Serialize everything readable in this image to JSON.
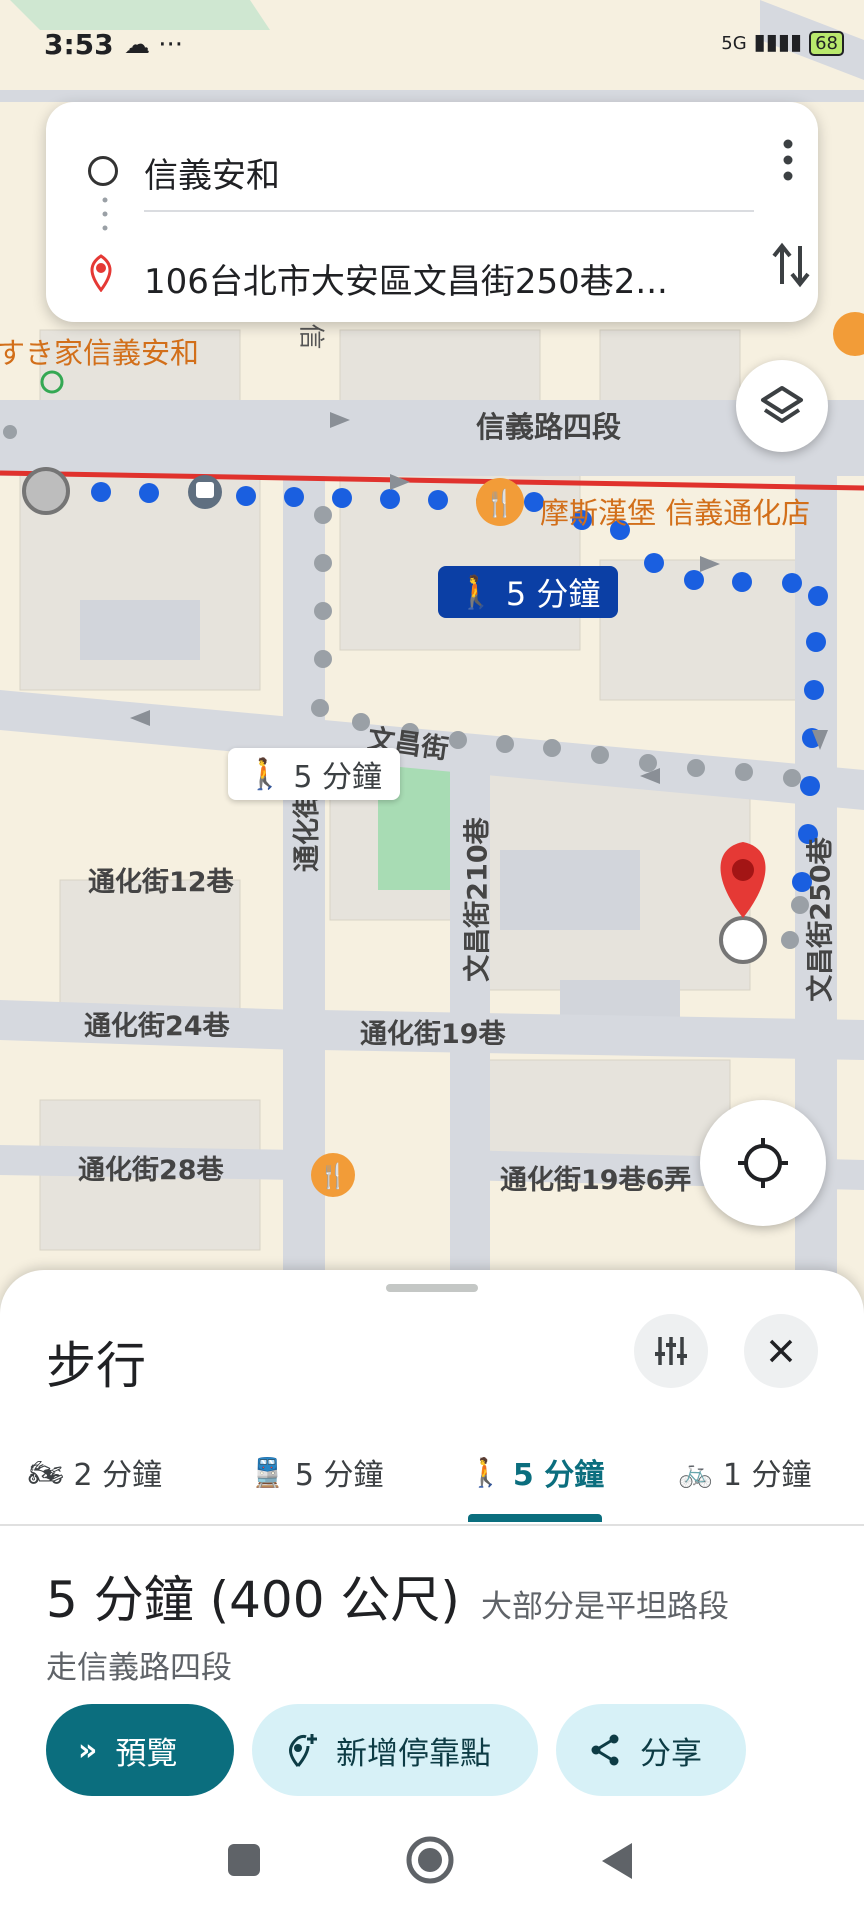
{
  "status_bar": {
    "time": "3:53",
    "extra": "☁ ···",
    "network": "5G",
    "battery": "68"
  },
  "search": {
    "origin": "信義安和",
    "destination": "106台北市大安區文昌街250巷2...",
    "origin_icon": "circle-outline-icon",
    "destination_icon": "location-pin-icon"
  },
  "map": {
    "labels": {
      "sukiya": "すき家信義安和",
      "xinyi_road": "信義路四段",
      "mos": "摩斯漢堡 信義通化店",
      "wenchang_st": "文昌街",
      "wenchang_210": "文昌街210巷",
      "wenchang_250": "文昌街250巷",
      "tonghua_st": "通化街",
      "tonghua_12": "通化街12巷",
      "tonghua_24": "通化街24巷",
      "tonghua_19": "通化街19巷",
      "tonghua_28": "通化街28巷",
      "tonghua_19_6": "通化街19巷6弄",
      "xin": "信"
    },
    "walk_badge_primary": "5 分鐘",
    "walk_badge_alt": "5 分鐘",
    "colors": {
      "route_blue": "#1a5fe0",
      "route_grey": "#9aa0a6",
      "mrt_red": "#e0322d",
      "pin_red": "#e53935",
      "poi_orange": "#f29c38"
    }
  },
  "sheet": {
    "title": "步行",
    "tabs": [
      {
        "icon": "motorcycle-icon",
        "label": "2 分鐘"
      },
      {
        "icon": "train-icon",
        "label": "5 分鐘"
      },
      {
        "icon": "walking-icon",
        "label": "5 分鐘"
      },
      {
        "icon": "bicycle-icon",
        "label": "1 分鐘"
      }
    ],
    "active_tab": 2,
    "summary_time": "5 分鐘 (400 公尺)",
    "summary_note": "大部分是平坦路段",
    "via": "走信義路四段",
    "buttons": {
      "preview": "預覽",
      "add_stop": "新增停靠點",
      "share": "分享"
    }
  },
  "accent_color": "#0b6e7e"
}
